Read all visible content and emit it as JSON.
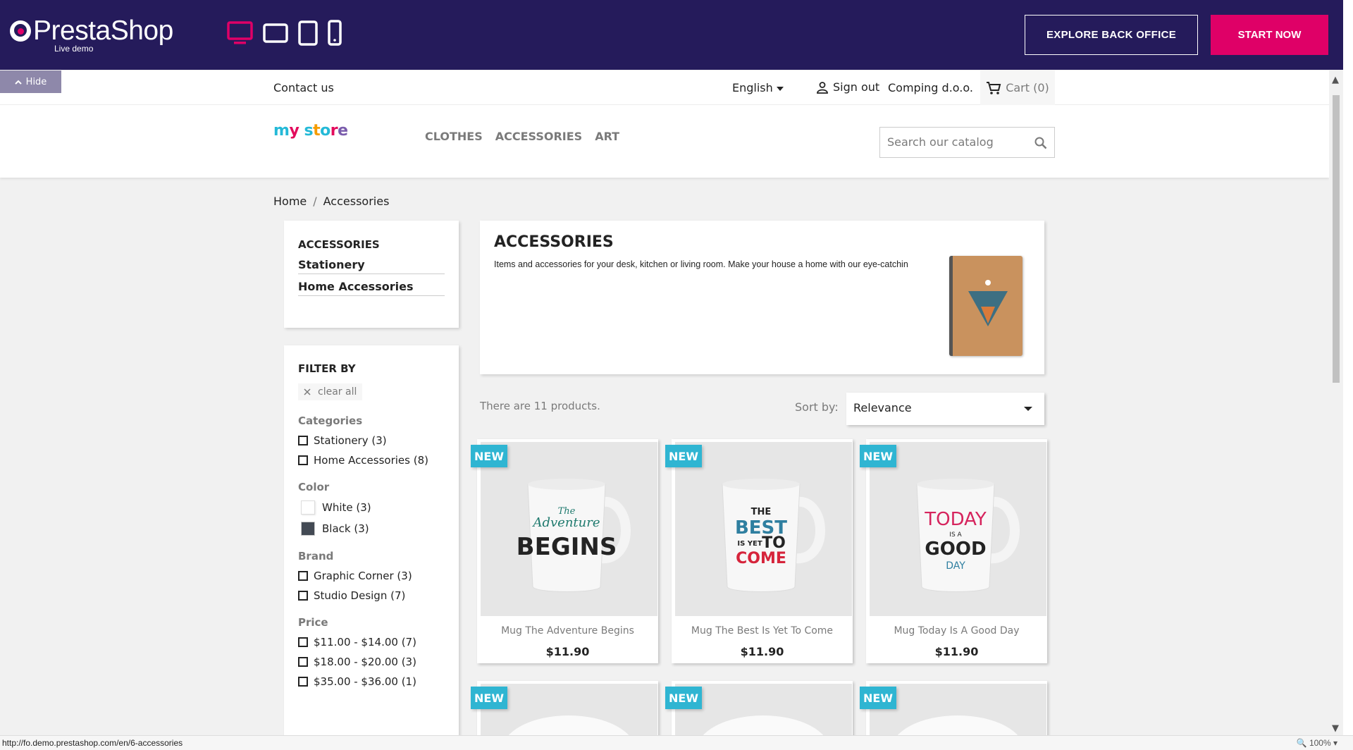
{
  "demo_bar": {
    "brand": "PrestaShop",
    "subtitle": "Live demo",
    "explore_label": "EXPLORE BACK OFFICE",
    "start_label": "START NOW",
    "hide_label": "Hide"
  },
  "nav": {
    "contact": "Contact us",
    "language": "English",
    "sign_out": "Sign out",
    "company": "Comping d.o.o.",
    "cart": "Cart (0)"
  },
  "header": {
    "logo_text": "my store",
    "menu": [
      "CLOTHES",
      "ACCESSORIES",
      "ART"
    ],
    "search_placeholder": "Search our catalog"
  },
  "breadcrumb": [
    "Home",
    "Accessories"
  ],
  "categories_block": {
    "title": "ACCESSORIES",
    "items": [
      "Stationery",
      "Home Accessories"
    ]
  },
  "filters": {
    "title": "FILTER BY",
    "clear_all": "clear all",
    "categories_title": "Categories",
    "categories": [
      "Stationery (3)",
      "Home Accessories (8)"
    ],
    "color_title": "Color",
    "colors": [
      {
        "label": "White (3)",
        "swatch": "#ffffff"
      },
      {
        "label": "Black (3)",
        "swatch": "#434a54"
      }
    ],
    "brand_title": "Brand",
    "brands": [
      "Graphic Corner (3)",
      "Studio Design (7)"
    ],
    "price_title": "Price",
    "prices": [
      "$11.00 - $14.00 (7)",
      "$18.00 - $20.00 (3)",
      "$35.00 - $36.00 (1)"
    ]
  },
  "category": {
    "title": "ACCESSORIES",
    "description": "Items and accessories for your desk, kitchen or living room. Make your house a home with our eye-catchin"
  },
  "listing": {
    "count_text": "There are 11 products.",
    "sort_label": "Sort by:",
    "sort_value": "Relevance"
  },
  "products": [
    {
      "badge": "NEW",
      "name": "Mug The Adventure Begins",
      "price": "$11.90"
    },
    {
      "badge": "NEW",
      "name": "Mug The Best Is Yet To Come",
      "price": "$11.90"
    },
    {
      "badge": "NEW",
      "name": "Mug Today Is A Good Day",
      "price": "$11.90"
    }
  ],
  "products_row2_badges": [
    "NEW",
    "NEW",
    "NEW"
  ],
  "mug_texts": [
    [
      "The",
      "Adventure",
      "BEGINS"
    ],
    [
      "THE",
      "BEST",
      "IS YET",
      "TO",
      "COME"
    ],
    [
      "TODAY",
      "IS A",
      "GOOD",
      "DAY"
    ]
  ],
  "status": {
    "url": "http://fo.demo.prestashop.com/en/6-accessories",
    "zoom": "100%"
  },
  "colors": {
    "demo_bar": "#251b5b",
    "accent_pink": "#df0067",
    "badge_blue": "#2fb5d2"
  }
}
